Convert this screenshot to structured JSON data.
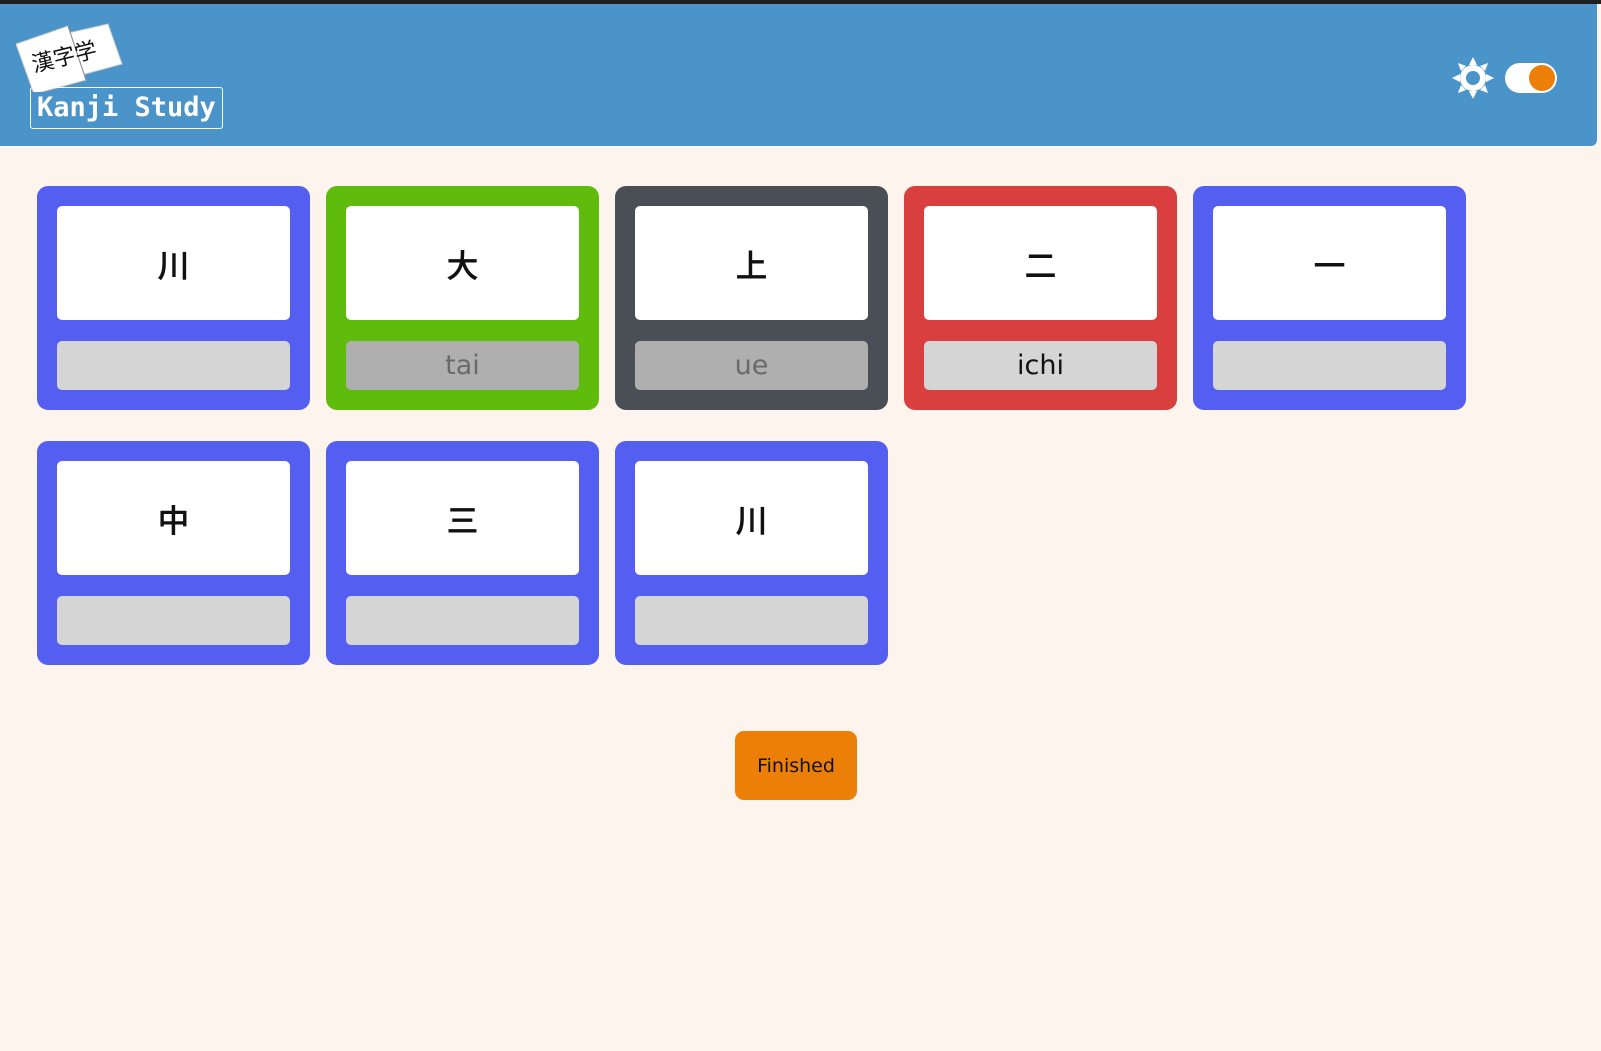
{
  "app": {
    "logo_card_text": "漢字学",
    "title": "Kanji Study"
  },
  "header": {
    "theme_icon": "sun-icon",
    "toggle_state": "on",
    "accent_color": "#ec7f08"
  },
  "cards": [
    {
      "kanji": "川",
      "answer": "",
      "state": "default"
    },
    {
      "kanji": "大",
      "answer": "tai",
      "state": "correct"
    },
    {
      "kanji": "上",
      "answer": "ue",
      "state": "revealed"
    },
    {
      "kanji": "二",
      "answer": "ichi",
      "state": "wrong"
    },
    {
      "kanji": "一",
      "answer": "",
      "state": "default"
    },
    {
      "kanji": "中",
      "answer": "",
      "state": "default"
    },
    {
      "kanji": "三",
      "answer": "",
      "state": "default"
    },
    {
      "kanji": "川",
      "answer": "",
      "state": "default"
    }
  ],
  "colors": {
    "header": "#4b94c9",
    "default": "#545ff1",
    "correct": "#5fbb0c",
    "revealed": "#4a4f56",
    "wrong": "#d93f3f",
    "background": "#fdf4ee"
  },
  "actions": {
    "finish_label": "Finished"
  }
}
